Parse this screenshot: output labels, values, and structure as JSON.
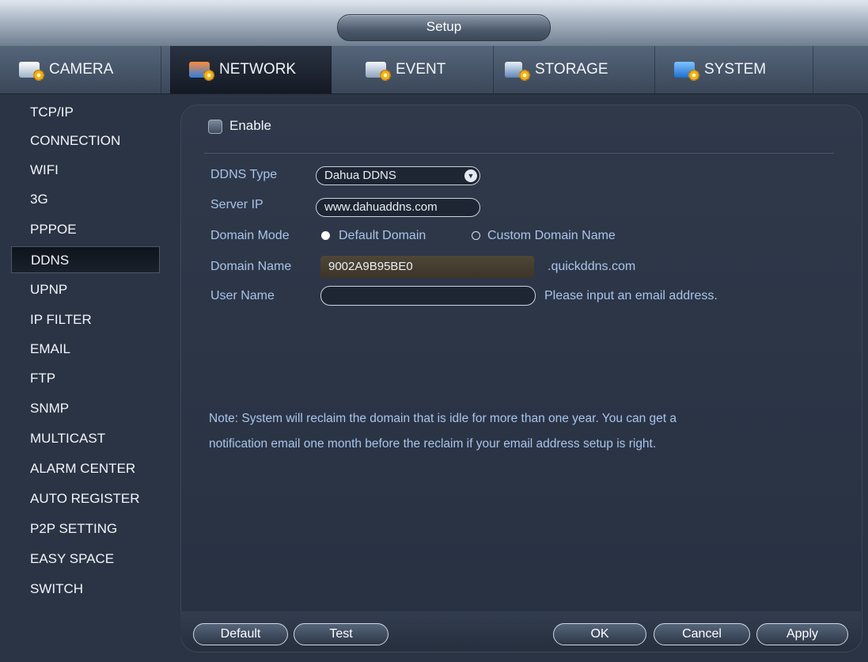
{
  "window": {
    "title": "Setup"
  },
  "tabs": [
    {
      "label": "CAMERA",
      "icon": "camera-settings-icon"
    },
    {
      "label": "NETWORK",
      "icon": "network-settings-icon",
      "active": true
    },
    {
      "label": "EVENT",
      "icon": "event-settings-icon"
    },
    {
      "label": "STORAGE",
      "icon": "storage-settings-icon"
    },
    {
      "label": "SYSTEM",
      "icon": "system-settings-icon"
    }
  ],
  "sidebar": {
    "items": [
      {
        "label": "TCP/IP"
      },
      {
        "label": "CONNECTION"
      },
      {
        "label": "WIFI"
      },
      {
        "label": "3G"
      },
      {
        "label": "PPPOE"
      },
      {
        "label": "DDNS",
        "active": true
      },
      {
        "label": "UPNP"
      },
      {
        "label": "IP FILTER"
      },
      {
        "label": "EMAIL"
      },
      {
        "label": "FTP"
      },
      {
        "label": "SNMP"
      },
      {
        "label": "MULTICAST"
      },
      {
        "label": "ALARM CENTER"
      },
      {
        "label": "AUTO REGISTER"
      },
      {
        "label": "P2P SETTING"
      },
      {
        "label": "EASY SPACE"
      },
      {
        "label": "SWITCH"
      }
    ]
  },
  "form": {
    "enable_label": "Enable",
    "enable_checked": false,
    "ddns_type_label": "DDNS Type",
    "ddns_type_value": "Dahua DDNS",
    "server_ip_label": "Server IP",
    "server_ip_value": "www.dahuaddns.com",
    "domain_mode_label": "Domain Mode",
    "domain_mode_default": "Default Domain",
    "domain_mode_custom": "Custom Domain Name",
    "domain_mode_selected": "Default Domain",
    "domain_name_label": "Domain Name",
    "domain_name_value": "9002A9B95BE0",
    "domain_suffix": ".quickddns.com",
    "user_name_label": "User Name",
    "user_name_value": "",
    "user_name_hint": "Please input an email address.",
    "note_line1": "Note: System will reclaim the domain that is idle for more than one year. You can get a",
    "note_line2": "notification email one month before the reclaim if your email address setup is right."
  },
  "buttons": {
    "default": "Default",
    "test": "Test",
    "ok": "OK",
    "cancel": "Cancel",
    "apply": "Apply"
  },
  "colors": {
    "background": "#2b3444",
    "label_blue": "#a9c4ea",
    "domain_field": "#4f4637"
  }
}
